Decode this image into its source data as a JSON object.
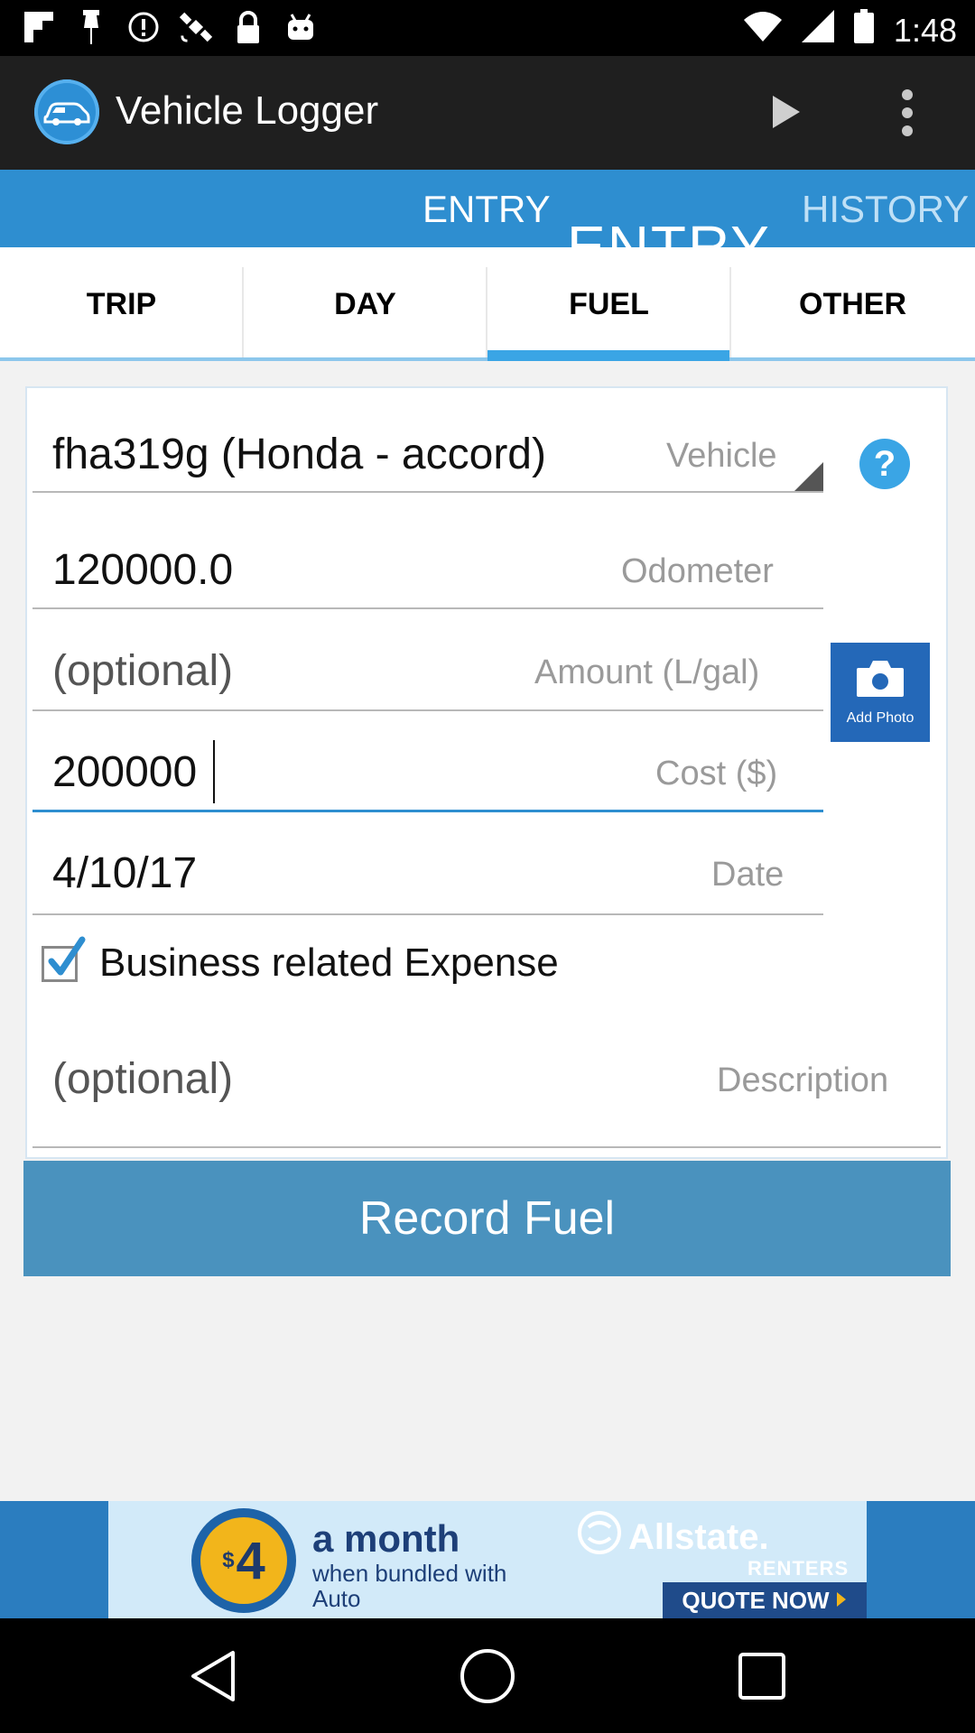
{
  "status_bar": {
    "time": "1:48",
    "icons": [
      "flipboard-icon",
      "notification-pin-icon",
      "info-icon",
      "satellite-icon",
      "lock-icon",
      "android-icon"
    ]
  },
  "app_bar": {
    "title": "Vehicle Logger",
    "logo_icon": "car-icon",
    "play_icon": "play-icon",
    "overflow_icon": "more-vert-icon"
  },
  "top_tabs": [
    {
      "label": "ENTRY",
      "active": true
    },
    {
      "label": "HISTORY",
      "active": false
    }
  ],
  "ghost_tab_text": "ENTRY",
  "sub_tabs": [
    {
      "label": "TRIP",
      "active": false
    },
    {
      "label": "DAY",
      "active": false
    },
    {
      "label": "FUEL",
      "active": true
    },
    {
      "label": "OTHER",
      "active": false
    }
  ],
  "form": {
    "vehicle": {
      "value": "fha319g (Honda - accord)",
      "label": "Vehicle"
    },
    "odometer": {
      "value": "120000.0",
      "label": "Odometer"
    },
    "amount": {
      "placeholder": "(optional)",
      "label": "Amount (L/gal)"
    },
    "cost": {
      "value": "200000",
      "label": "Cost ($)"
    },
    "date": {
      "value": "4/10/17",
      "label": "Date"
    },
    "business_expense": {
      "label": "Business related Expense",
      "checked": true
    },
    "description": {
      "placeholder": "(optional)",
      "label": "Description"
    },
    "help_icon": "?",
    "add_photo_label": "Add Photo",
    "submit_label": "Record Fuel"
  },
  "ad": {
    "price_symbol": "$",
    "price": "4",
    "headline": "a month",
    "subline": "when bundled with Auto",
    "brand": "Allstate.",
    "brand_sub": "RENTERS",
    "cta": "QUOTE NOW"
  },
  "nav": {
    "back_icon": "back-icon",
    "home_icon": "home-icon",
    "recents_icon": "recents-icon"
  },
  "colors": {
    "accent": "#2E8ED0",
    "button": "#4A92BE",
    "photo_button": "#2468B8"
  }
}
